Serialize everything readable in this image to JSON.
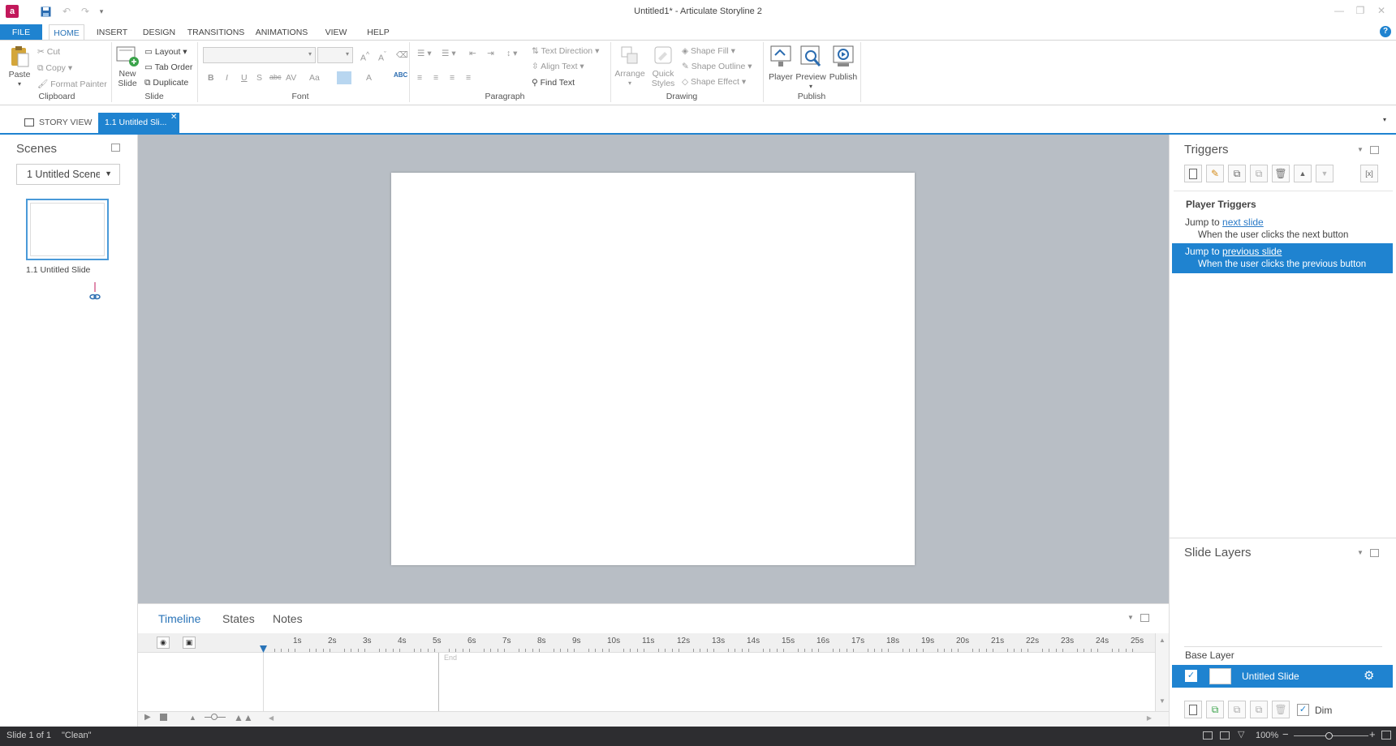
{
  "window": {
    "title": "Untitled1* - Articulate Storyline 2"
  },
  "ribbon_tabs": [
    "FILE",
    "HOME",
    "INSERT",
    "DESIGN",
    "TRANSITIONS",
    "ANIMATIONS",
    "VIEW",
    "HELP"
  ],
  "clipboard": {
    "paste": "Paste",
    "cut": "Cut",
    "copy": "Copy",
    "format_painter": "Format Painter",
    "label": "Clipboard"
  },
  "slide_group": {
    "new_slide_line1": "New",
    "new_slide_line2": "Slide",
    "layout": "Layout",
    "tab_order": "Tab Order",
    "duplicate": "Duplicate",
    "label": "Slide"
  },
  "font_group": {
    "label": "Font",
    "bold": "B",
    "italic": "I",
    "underline": "U",
    "strike": "S",
    "abc": "abc",
    "av": "AV",
    "aa": "Aa",
    "a_upper": "A",
    "a_lower": "A",
    "abc_check": "ABC"
  },
  "paragraph_group": {
    "text_direction": "Text Direction",
    "align_text": "Align Text",
    "find_text": "Find Text",
    "label": "Paragraph"
  },
  "drawing_group": {
    "arrange": "Arrange",
    "quick_styles_line1": "Quick",
    "quick_styles_line2": "Styles",
    "shape_fill": "Shape Fill",
    "shape_outline": "Shape Outline",
    "shape_effect": "Shape Effect",
    "label": "Drawing"
  },
  "publish_group": {
    "player": "Player",
    "preview": "Preview",
    "publish": "Publish",
    "label": "Publish"
  },
  "doc_tabs": {
    "story_view": "STORY VIEW",
    "active_tab": "1.1 Untitled Sli..."
  },
  "scenes": {
    "title": "Scenes",
    "dropdown": "1 Untitled Scene",
    "thumb_label": "1.1 Untitled Slide"
  },
  "timeline": {
    "tabs": [
      "Timeline",
      "States",
      "Notes"
    ],
    "ticks": [
      "1s",
      "2s",
      "3s",
      "4s",
      "5s",
      "6s",
      "7s",
      "8s",
      "9s",
      "10s",
      "11s",
      "12s",
      "13s",
      "14s",
      "15s",
      "16s",
      "17s",
      "18s",
      "19s",
      "20s",
      "21s",
      "22s",
      "23s",
      "24s",
      "25s"
    ],
    "end_label": "End"
  },
  "triggers": {
    "title": "Triggers",
    "section": "Player Triggers",
    "items": [
      {
        "action": "Jump to",
        "target": "next slide",
        "condition": "When the user clicks the next button"
      },
      {
        "action": "Jump to",
        "target": "previous slide",
        "condition": "When the user clicks the previous button"
      }
    ]
  },
  "slide_layers": {
    "title": "Slide Layers",
    "base_layer": "Base Layer",
    "layer_name": "Untitled Slide",
    "dim": "Dim"
  },
  "status": {
    "slide": "Slide 1 of 1",
    "state": "\"Clean\"",
    "zoom": "100%"
  },
  "colors": {
    "accent": "#1f83d0",
    "canvas": "#b8bec5",
    "statusbar": "#2d2d30"
  }
}
